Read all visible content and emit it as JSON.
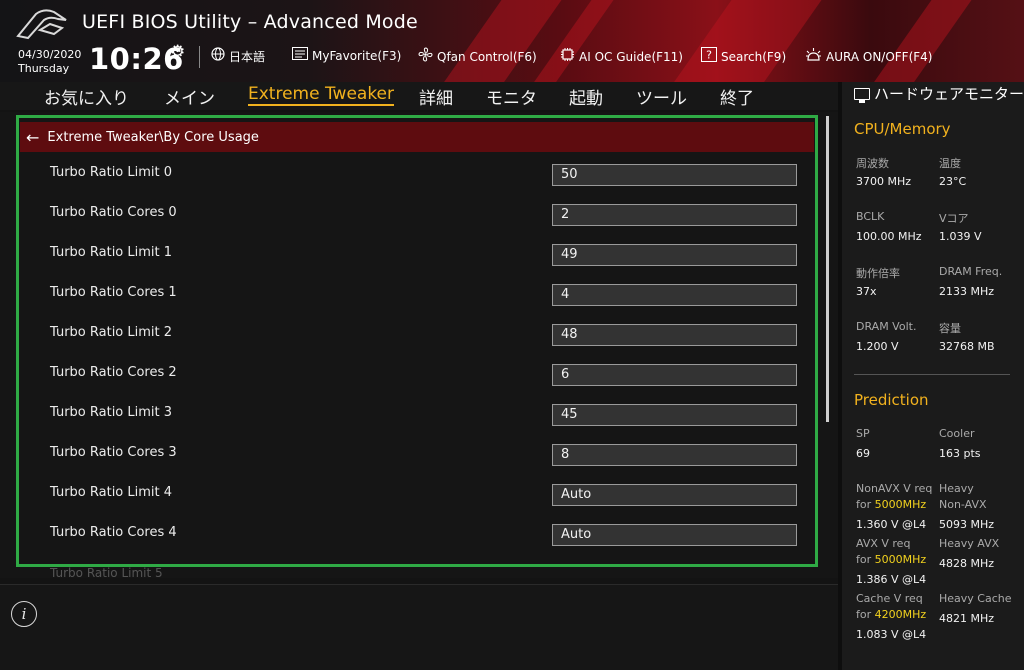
{
  "header": {
    "title": "UEFI BIOS Utility – Advanced Mode",
    "date": "04/30/2020",
    "day": "Thursday",
    "time": "10:26",
    "language": "日本語",
    "myfavorite": "MyFavorite(F3)",
    "qfan": "Qfan Control(F6)",
    "aioc": "AI OC Guide(F11)",
    "search": "Search(F9)",
    "aura": "AURA ON/OFF(F4)"
  },
  "menu": {
    "items": [
      "お気に入り",
      "メイン",
      "Extreme Tweaker",
      "詳細",
      "モニタ",
      "起動",
      "ツール",
      "終了"
    ],
    "active": "Extreme Tweaker"
  },
  "main": {
    "breadcrumb": "Extreme Tweaker\\By Core Usage",
    "rows": [
      {
        "label": "Turbo Ratio Limit 0",
        "value": "50"
      },
      {
        "label": "Turbo Ratio Cores 0",
        "value": "2"
      },
      {
        "label": "Turbo Ratio Limit 1",
        "value": "49"
      },
      {
        "label": "Turbo Ratio Cores 1",
        "value": "4"
      },
      {
        "label": "Turbo Ratio Limit 2",
        "value": "48"
      },
      {
        "label": "Turbo Ratio Cores 2",
        "value": "6"
      },
      {
        "label": "Turbo Ratio Limit 3",
        "value": "45"
      },
      {
        "label": "Turbo Ratio Cores 3",
        "value": "8"
      },
      {
        "label": "Turbo Ratio Limit 4",
        "value": "Auto"
      },
      {
        "label": "Turbo Ratio Cores 4",
        "value": "Auto"
      }
    ],
    "clipped_row": "Turbo Ratio Limit 5"
  },
  "panel": {
    "title": "ハードウェアモニター",
    "cpu_section": "CPU/Memory",
    "freq_label": "周波数",
    "freq_value": "3700 MHz",
    "temp_label": "温度",
    "temp_value": "23°C",
    "bclk_label": "BCLK",
    "bclk_value": "100.00 MHz",
    "vcore_label": "Vコア",
    "vcore_value": "1.039 V",
    "ratio_label": "動作倍率",
    "ratio_value": "37x",
    "dramfreq_label": "DRAM Freq.",
    "dramfreq_value": "2133 MHz",
    "dramvolt_label": "DRAM Volt.",
    "dramvolt_value": "1.200 V",
    "capacity_label": "容量",
    "capacity_value": "32768 MB",
    "prediction_section": "Prediction",
    "sp_label": "SP",
    "sp_value": "69",
    "cooler_label": "Cooler",
    "cooler_value": "163 pts",
    "nonavx_label": "NonAVX V req",
    "nonavx_for": "for",
    "nonavx_freq": "5000MHz",
    "nonavx_value": "1.360 V @L4",
    "heavy_nonavx_label1": "Heavy",
    "heavy_nonavx_label2": "Non-AVX",
    "heavy_nonavx_value": "5093 MHz",
    "avx_label": "AVX V req",
    "avx_for": "for",
    "avx_freq": "5000MHz",
    "avx_value": "1.386 V @L4",
    "heavy_avx_label": "Heavy AVX",
    "heavy_avx_value": "4828 MHz",
    "cache_label": "Cache V req",
    "cache_for": "for",
    "cache_freq": "4200MHz",
    "cache_value": "1.083 V @L4",
    "heavy_cache_label": "Heavy Cache",
    "heavy_cache_value": "4821 MHz"
  },
  "colors": {
    "accent": "#f2b21e",
    "highlight_frame": "#2faa45",
    "breadcrumb_bg": "#5e0c0f",
    "prediction_freq": "#f2d21e"
  }
}
